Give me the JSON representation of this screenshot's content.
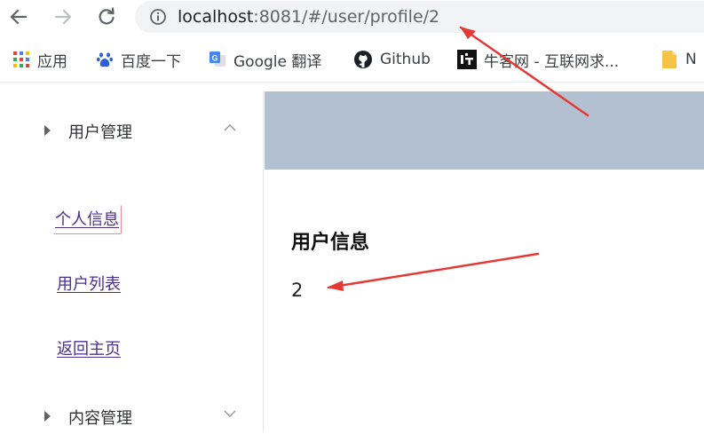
{
  "browser": {
    "url_host": "localhost",
    "url_rest": ":8081/#/user/profile/2"
  },
  "bookmarks": [
    {
      "icon": "apps-grid-icon",
      "label": "应用"
    },
    {
      "icon": "baidu-paw-icon",
      "label": "百度一下"
    },
    {
      "icon": "google-translate-icon",
      "label": "Google 翻译"
    },
    {
      "icon": "github-icon",
      "label": "Github"
    },
    {
      "icon": "nowcoder-icon",
      "label": "牛客网 - 互联网求..."
    },
    {
      "icon": "folder-icon",
      "label": "N"
    }
  ],
  "sidebar": {
    "menus": [
      {
        "label": "用户管理",
        "expanded": true
      },
      {
        "label": "内容管理",
        "expanded": false
      }
    ],
    "links": [
      {
        "label": "个人信息",
        "active": true
      },
      {
        "label": "用户列表",
        "active": false
      },
      {
        "label": "返回主页",
        "active": false
      }
    ]
  },
  "main": {
    "heading": "用户信息",
    "value": "2"
  },
  "colors": {
    "header_bg": "#b3c0d1",
    "link": "#4a2f8f",
    "annotation_arrow": "#e53935"
  }
}
